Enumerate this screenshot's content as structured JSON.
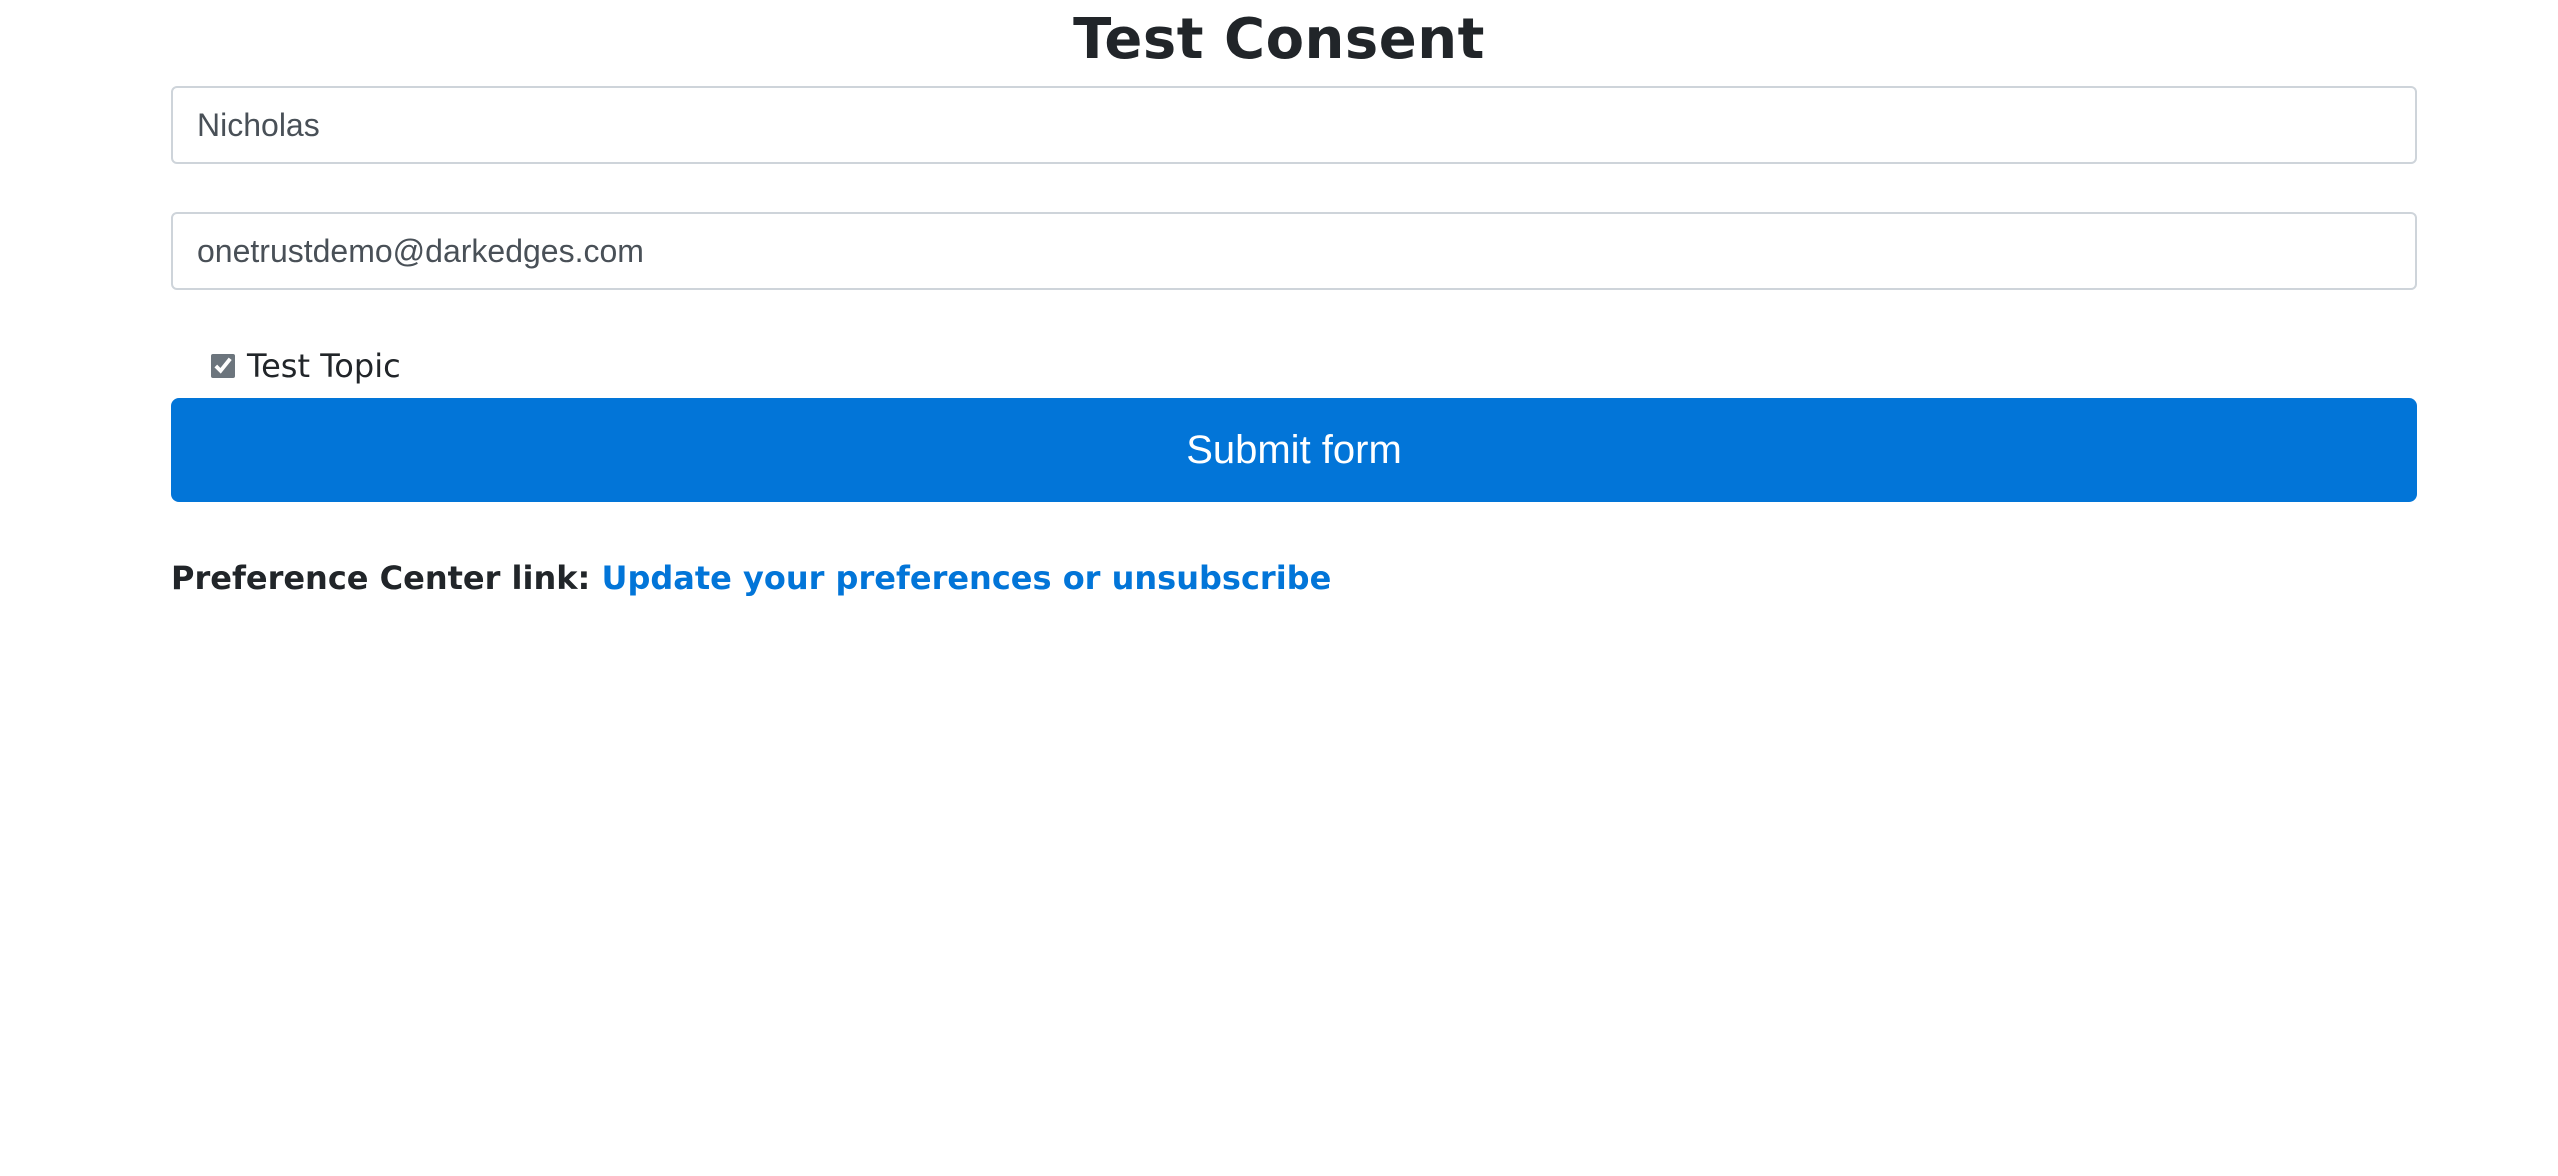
{
  "page": {
    "title": "Test Consent"
  },
  "form": {
    "name_value": "Nicholas",
    "email_value": "onetrustdemo@darkedges.com",
    "topic_label": "Test Topic",
    "topic_checked": true,
    "submit_label": "Submit form"
  },
  "preference": {
    "label": "Preference Center link:",
    "link_text": "Update your preferences or unsubscribe"
  },
  "colors": {
    "primary": "#0275d8",
    "text": "#212529",
    "input_border": "#ced4da"
  }
}
